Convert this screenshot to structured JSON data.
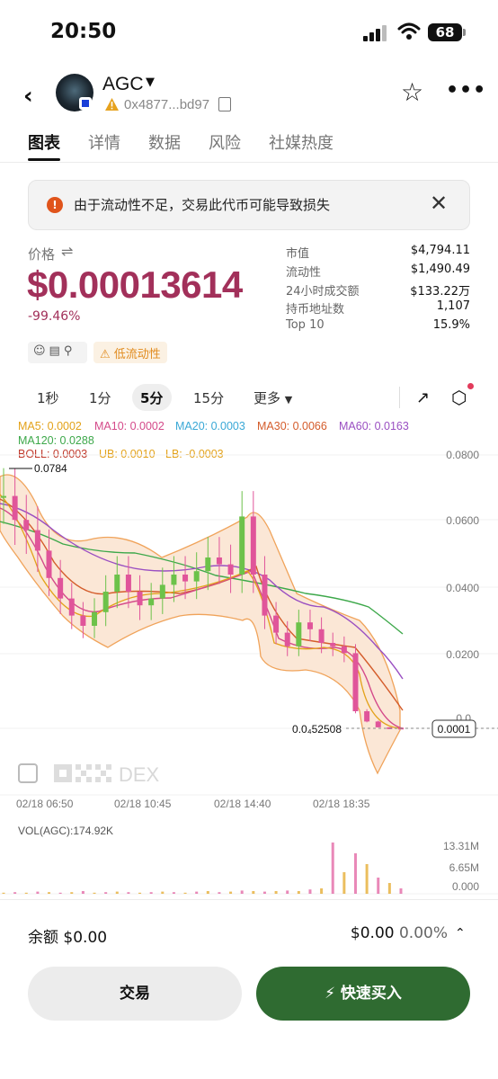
{
  "status_bar": {
    "time": "20:50",
    "battery": "68"
  },
  "header": {
    "token_name": "AGC",
    "address": "0x4877...bd97"
  },
  "tabs": [
    {
      "label": "图表",
      "active": true
    },
    {
      "label": "详情"
    },
    {
      "label": "数据"
    },
    {
      "label": "风险"
    },
    {
      "label": "社媒热度"
    }
  ],
  "alert": {
    "text": "由于流动性不足，交易此代币可能导致损失"
  },
  "price": {
    "label": "价格",
    "value": "$0.00013614",
    "change": "-99.46%",
    "low_liquidity_tag": "低流动性"
  },
  "stats": [
    {
      "label": "市值",
      "value": "$4,794.11"
    },
    {
      "label": "流动性",
      "value": "$1,490.49"
    },
    {
      "label": "24小时成交额",
      "value": "$133.22万"
    },
    {
      "label": "持币地址数",
      "value": "1,107"
    },
    {
      "label": "Top 10",
      "value": "15.9%"
    }
  ],
  "intervals": {
    "items": [
      "1秒",
      "1分",
      "5分",
      "15分"
    ],
    "active": "5分",
    "more": "更多"
  },
  "indicators": {
    "ma5": "MA5: 0.0002",
    "ma10": "MA10: 0.0002",
    "ma20": "MA20: 0.0003",
    "ma30": "MA30: 0.0066",
    "ma60": "MA60: 0.0163",
    "ma120": "MA120: 0.0288",
    "boll": "BOLL: 0.0003",
    "ub": "UB: 0.0010",
    "lb": "LB: -0.0003"
  },
  "colors": {
    "ma5": "#e3a21a",
    "ma10": "#d44a8a",
    "ma20": "#3aa8d6",
    "ma30": "#d45c2b",
    "ma60": "#9a4fc2",
    "ma120": "#3da84a",
    "boll": "#c0392b",
    "up": "#6cc24a",
    "down": "#e0559a",
    "accent_price": "#a2305a",
    "buy_button": "#2f6b31"
  },
  "chart_data": {
    "type": "candlestick",
    "y_axis_labels": [
      "0.0800",
      "0.0600",
      "0.0400",
      "0.0200",
      "0.0"
    ],
    "x_axis_labels": [
      "02/18 06:50",
      "02/18 10:45",
      "02/18 14:40",
      "02/18 18:35"
    ],
    "high_marker": "0.0784",
    "current_marker_left": "0.0₄52508",
    "current_marker_right": "0.0001",
    "closes": [
      0.068,
      0.061,
      0.058,
      0.052,
      0.044,
      0.038,
      0.033,
      0.03,
      0.034,
      0.04,
      0.045,
      0.04,
      0.036,
      0.038,
      0.042,
      0.045,
      0.043,
      0.046,
      0.05,
      0.048,
      0.045,
      0.062,
      0.045,
      0.033,
      0.028,
      0.024,
      0.031,
      0.029,
      0.025,
      0.024,
      0.022,
      0.005,
      0.002,
      0.0003,
      0.0002,
      0.0001
    ],
    "ma_lines": {
      "ma120": [
        0.064,
        0.062,
        0.06,
        0.057,
        0.055,
        0.053,
        0.051,
        0.05,
        0.049,
        0.048,
        0.047,
        0.046,
        0.045,
        0.045,
        0.044,
        0.044,
        0.044,
        0.043,
        0.043,
        0.042,
        0.042,
        0.042,
        0.041,
        0.041,
        0.04,
        0.039,
        0.038,
        0.037,
        0.036,
        0.035,
        0.033,
        0.031,
        0.029,
        0.027
      ],
      "ma60": [
        0.066,
        0.063,
        0.06,
        0.055,
        0.051,
        0.047,
        0.044,
        0.042,
        0.041,
        0.041,
        0.041,
        0.04,
        0.04,
        0.04,
        0.041,
        0.042,
        0.042,
        0.043,
        0.044,
        0.044,
        0.044,
        0.045,
        0.043,
        0.04,
        0.037,
        0.035,
        0.033,
        0.031,
        0.03,
        0.028,
        0.026,
        0.023,
        0.02,
        0.016
      ]
    },
    "volume_label": "VOL(AGC):174.92K",
    "volume_axis": [
      "13.31M",
      "6.65M",
      "0.000"
    ]
  },
  "watermark": "DEX",
  "bottom": {
    "balance": "余额 $0.00",
    "value": "$0.00",
    "pct": "0.00%",
    "trade_button": "交易",
    "buy_button": "快速买入"
  }
}
